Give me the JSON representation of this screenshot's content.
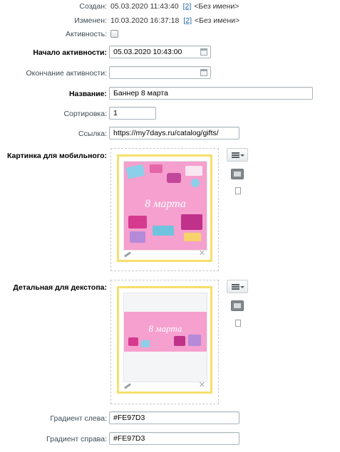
{
  "meta": {
    "created_label": "Создан:",
    "created_date": "05.03.2020 11:43:40",
    "created_user_link": "[2]",
    "created_user_name": "<Без имени>",
    "modified_label": "Изменен:",
    "modified_date": "10.03.2020 16:37:18",
    "modified_user_link": "[2]",
    "modified_user_name": "<Без имени>"
  },
  "fields": {
    "active_label": "Активность:",
    "active_checked": false,
    "start_label": "Начало активности:",
    "start_value": "05.03.2020 10:43:00",
    "end_label": "Окончание активности:",
    "end_value": "",
    "name_label": "Название:",
    "name_value": "Баннер 8 марта",
    "sort_label": "Сортировка:",
    "sort_value": "1",
    "link_label": "Ссылка:",
    "link_value": "https://my7days.ru/catalog/gifts/",
    "mobile_image_label": "Картинка для мобильного:",
    "mobile_banner_text": "8 марта",
    "desktop_image_label": "Детальная для декстопа:",
    "desktop_banner_text": "8 марта",
    "gradient_left_label": "Градиент слева:",
    "gradient_left_value": "#FE97D3",
    "gradient_right_label": "Градиент справа:",
    "gradient_right_value": "#FE97D3"
  },
  "icons": {
    "calendar": "calendar-icon",
    "menu": "menu-icon",
    "image": "image-icon",
    "file": "file-icon",
    "edit": "pencil-icon",
    "delete": "close-icon"
  },
  "colors": {
    "banner_pink": "#FE97D3",
    "frame_yellow": "#F6DF6B",
    "link": "#2067B0"
  }
}
